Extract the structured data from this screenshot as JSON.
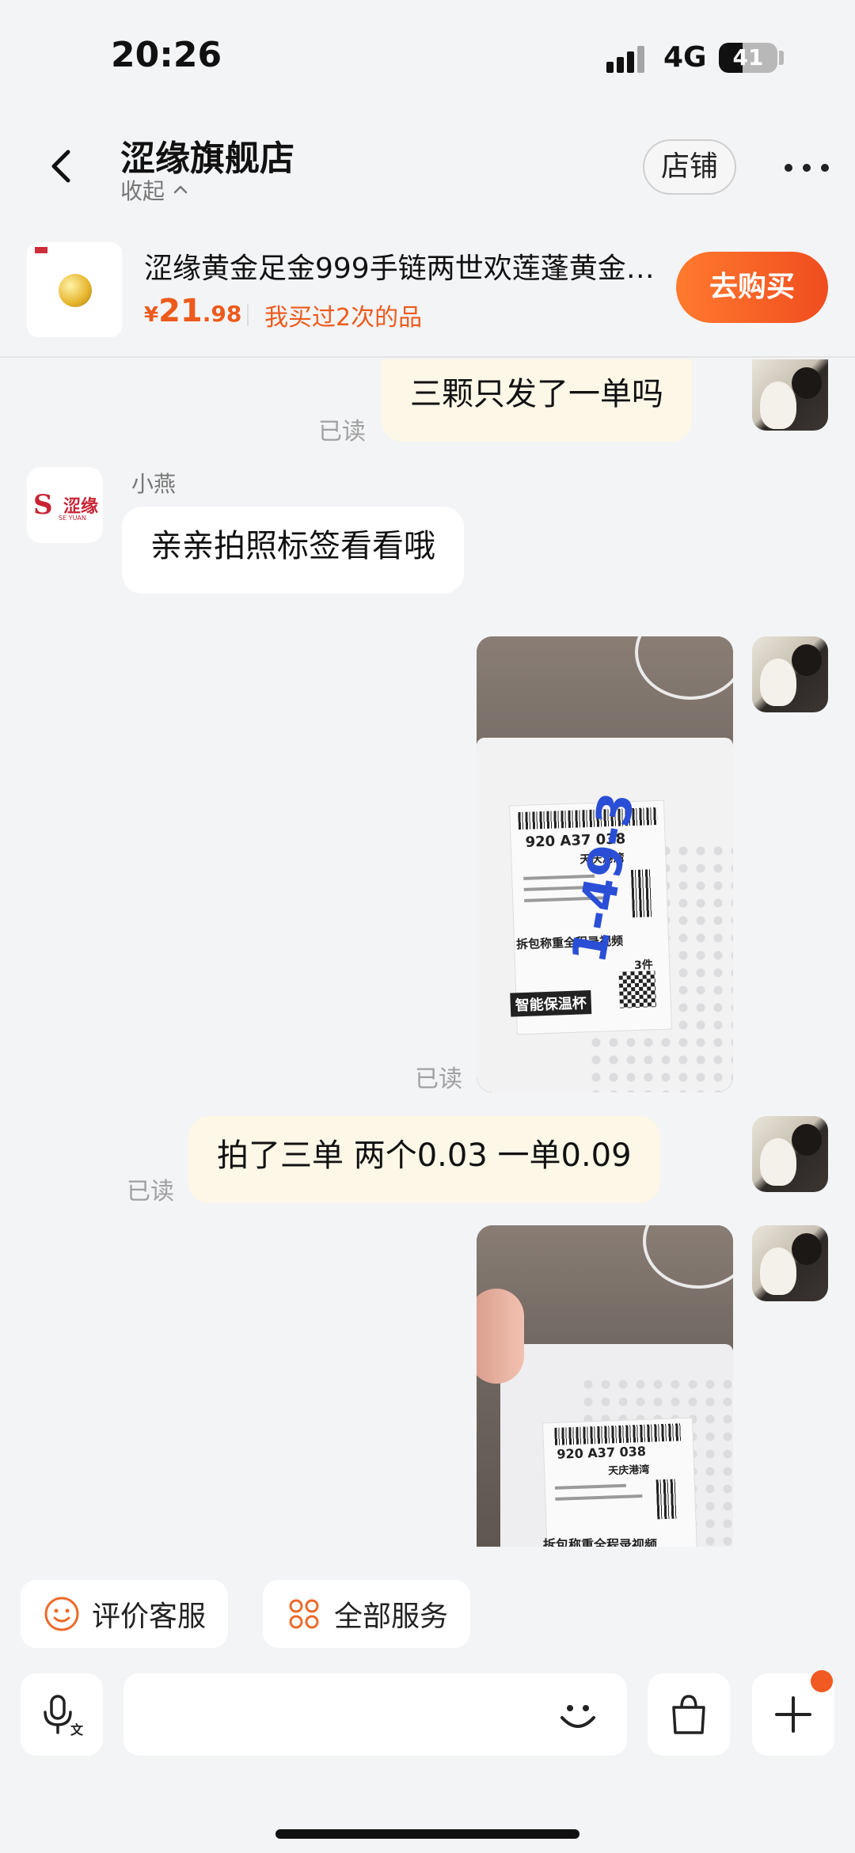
{
  "status_bar": {
    "time": "20:26",
    "network": "4G",
    "battery": "41",
    "battery_level": 0.41
  },
  "header": {
    "back_icon": "chevron-left-icon",
    "shop_name": "涩缘旗舰店",
    "collapse_label": "收起",
    "shop_button": "店铺",
    "more_icon": "more-horizontal-icon"
  },
  "product": {
    "name": "涩缘黄金足金999手链两世欢莲蓬黄金…",
    "price_symbol": "¥",
    "price_int": "21",
    "price_dec": ".98",
    "bought_text": "我买过2次的品",
    "buy_button": "去购买"
  },
  "messages": {
    "m1": {
      "text": "三颗只发了一单吗",
      "status": "已读"
    },
    "m2": {
      "sender": "小燕",
      "text": "亲亲拍照标签看看哦"
    },
    "m3": {
      "status": "已读",
      "label_code": "920 A37 038",
      "label_location": "天庆港湾",
      "label_notice": "拆包称重全程录视频",
      "label_count": "3件",
      "label_brand": "智能保温杯",
      "handwriting": "1-49-3"
    },
    "m4": {
      "text": "拍了三单  两个0.03  一单0.09",
      "status": "已读"
    },
    "m5": {
      "label_code": "920 A37 038",
      "label_location": "天庆港湾",
      "label_notice": "拆包称重全程录视频"
    }
  },
  "services": {
    "rate": {
      "label": "评价客服",
      "icon": "smile-icon"
    },
    "all": {
      "label": "全部服务",
      "icon": "grid-icon"
    }
  },
  "input_bar": {
    "voice_icon": "voice-translate-icon",
    "emoji_icon": "emoji-icon",
    "bag_icon": "shopping-bag-icon",
    "plus_icon": "plus-icon",
    "input_value": ""
  },
  "colors": {
    "accent": "#f04d1f",
    "price": "#ec5a1c",
    "bubble_me": "#fdf7e7",
    "background": "#f3f4f6"
  }
}
